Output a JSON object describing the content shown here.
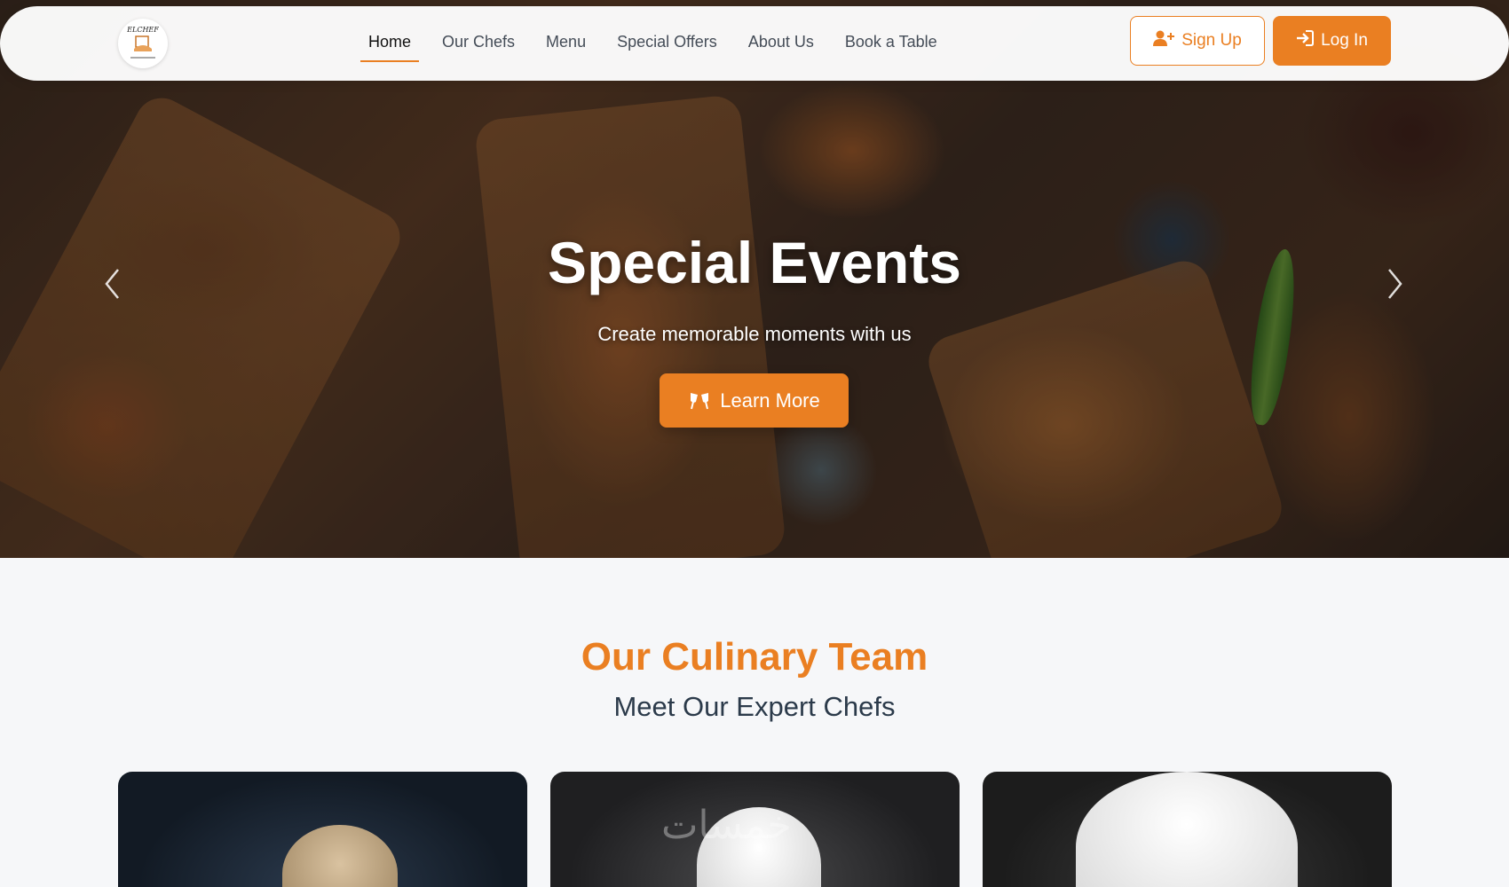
{
  "nav": {
    "logo_text": "ELCHEF",
    "links": [
      {
        "label": "Home",
        "active": true
      },
      {
        "label": "Our Chefs",
        "active": false
      },
      {
        "label": "Menu",
        "active": false
      },
      {
        "label": "Special Offers",
        "active": false
      },
      {
        "label": "About Us",
        "active": false
      },
      {
        "label": "Book a Table",
        "active": false
      }
    ],
    "signup_label": "Sign Up",
    "login_label": "Log In"
  },
  "hero": {
    "title": "Special Events",
    "subtitle": "Create memorable moments with us",
    "cta_label": "Learn More",
    "cta_icon": "glasses-cheers-icon",
    "prev_icon": "chevron-left-icon",
    "next_icon": "chevron-right-icon"
  },
  "team": {
    "title": "Our Culinary Team",
    "subtitle": "Meet Our Expert Chefs",
    "watermark": "خمسات"
  },
  "colors": {
    "accent": "#ea7f22",
    "heading_dark": "#2b3a4a",
    "page_bg": "#f6f7f9"
  }
}
